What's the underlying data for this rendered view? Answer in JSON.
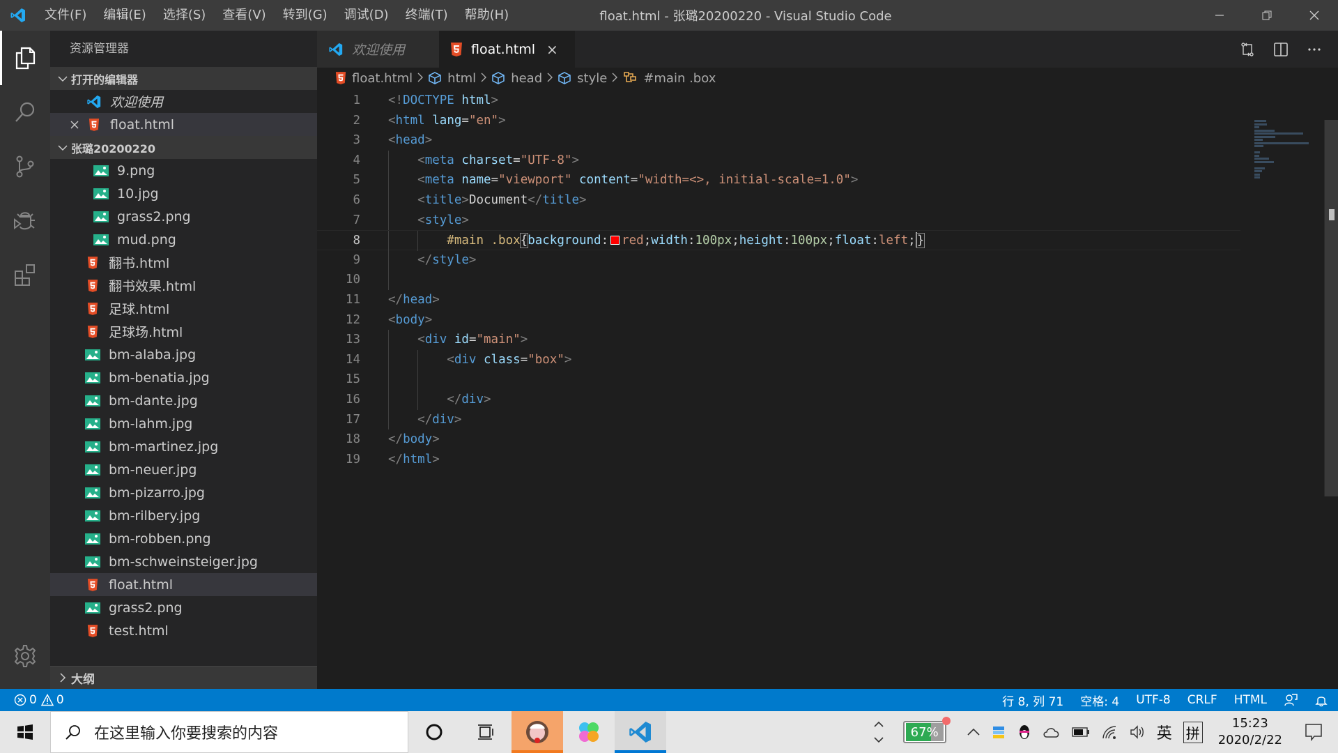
{
  "window": {
    "title": "float.html - 张璐20200220 - Visual Studio Code",
    "menu": [
      "文件(F)",
      "编辑(E)",
      "选择(S)",
      "查看(V)",
      "转到(G)",
      "调试(D)",
      "终端(T)",
      "帮助(H)"
    ]
  },
  "activity_bar": {
    "items": [
      "explorer-icon",
      "search-icon",
      "source-control-icon",
      "debug-icon",
      "extensions-icon"
    ],
    "bottom": "gear-icon"
  },
  "sidebar": {
    "title": "资源管理器",
    "open_editors": {
      "label": "打开的编辑器",
      "items": [
        {
          "label": "欢迎使用",
          "icon": "vscode-icon",
          "italic": true
        },
        {
          "label": "float.html",
          "icon": "html5-icon",
          "closable": true
        }
      ]
    },
    "folder": {
      "label": "张璐20200220",
      "items": [
        {
          "label": "9.png",
          "icon": "image-icon",
          "indent": 2
        },
        {
          "label": "10.jpg",
          "icon": "image-icon",
          "indent": 2
        },
        {
          "label": "grass2.png",
          "icon": "image-icon",
          "indent": 2
        },
        {
          "label": "mud.png",
          "icon": "image-icon",
          "indent": 2
        },
        {
          "label": "翻书.html",
          "icon": "html5-icon",
          "indent": 1
        },
        {
          "label": "翻书效果.html",
          "icon": "html5-icon",
          "indent": 1
        },
        {
          "label": "足球.html",
          "icon": "html5-icon",
          "indent": 1
        },
        {
          "label": "足球场.html",
          "icon": "html5-icon",
          "indent": 1
        },
        {
          "label": "bm-alaba.jpg",
          "icon": "image-icon",
          "indent": 1
        },
        {
          "label": "bm-benatia.jpg",
          "icon": "image-icon",
          "indent": 1
        },
        {
          "label": "bm-dante.jpg",
          "icon": "image-icon",
          "indent": 1
        },
        {
          "label": "bm-lahm.jpg",
          "icon": "image-icon",
          "indent": 1
        },
        {
          "label": "bm-martinez.jpg",
          "icon": "image-icon",
          "indent": 1
        },
        {
          "label": "bm-neuer.jpg",
          "icon": "image-icon",
          "indent": 1
        },
        {
          "label": "bm-pizarro.jpg",
          "icon": "image-icon",
          "indent": 1
        },
        {
          "label": "bm-rilbery.jpg",
          "icon": "image-icon",
          "indent": 1
        },
        {
          "label": "bm-robben.png",
          "icon": "image-icon",
          "indent": 1
        },
        {
          "label": "bm-schweinsteiger.jpg",
          "icon": "image-icon",
          "indent": 1
        },
        {
          "label": "float.html",
          "icon": "html5-icon",
          "indent": 1,
          "selected": true
        },
        {
          "label": "grass2.png",
          "icon": "image-icon",
          "indent": 1
        },
        {
          "label": "test.html",
          "icon": "html5-icon",
          "indent": 1
        }
      ]
    },
    "outline_label": "大纲"
  },
  "tabs": [
    {
      "label": "欢迎使用",
      "icon": "vscode-icon",
      "active": false
    },
    {
      "label": "float.html",
      "icon": "html5-icon",
      "active": true,
      "close": "×"
    }
  ],
  "breadcrumb": [
    {
      "label": "float.html",
      "icon": "html5-icon"
    },
    {
      "label": "html",
      "icon": "element-icon"
    },
    {
      "label": "head",
      "icon": "element-icon"
    },
    {
      "label": "style",
      "icon": "element-icon"
    },
    {
      "label": "#main .box",
      "icon": "css-selector-icon"
    }
  ],
  "code": {
    "current_line": 8,
    "lines": [
      [
        [
          "t-br",
          "<!"
        ],
        [
          "t-tag",
          "DOCTYPE"
        ],
        [
          "t-txt",
          " "
        ],
        [
          "t-attr",
          "html"
        ],
        [
          "t-br",
          ">"
        ]
      ],
      [
        [
          "t-br",
          "<"
        ],
        [
          "t-tag",
          "html"
        ],
        [
          "t-txt",
          " "
        ],
        [
          "t-attr",
          "lang"
        ],
        [
          "t-txt",
          "="
        ],
        [
          "t-str",
          "\"en\""
        ],
        [
          "t-br",
          ">"
        ]
      ],
      [
        [
          "t-br",
          "<"
        ],
        [
          "t-tag",
          "head"
        ],
        [
          "t-br",
          ">"
        ]
      ],
      [
        [
          "t-txt",
          "    "
        ],
        [
          "t-br",
          "<"
        ],
        [
          "t-tag",
          "meta"
        ],
        [
          "t-txt",
          " "
        ],
        [
          "t-attr",
          "charset"
        ],
        [
          "t-txt",
          "="
        ],
        [
          "t-str",
          "\"UTF-8\""
        ],
        [
          "t-br",
          ">"
        ]
      ],
      [
        [
          "t-txt",
          "    "
        ],
        [
          "t-br",
          "<"
        ],
        [
          "t-tag",
          "meta"
        ],
        [
          "t-txt",
          " "
        ],
        [
          "t-attr",
          "name"
        ],
        [
          "t-txt",
          "="
        ],
        [
          "t-str",
          "\"viewport\""
        ],
        [
          "t-txt",
          " "
        ],
        [
          "t-attr",
          "content"
        ],
        [
          "t-txt",
          "="
        ],
        [
          "t-str",
          "\"width=<>, initial-scale=1.0\""
        ],
        [
          "t-br",
          ">"
        ]
      ],
      [
        [
          "t-txt",
          "    "
        ],
        [
          "t-br",
          "<"
        ],
        [
          "t-tag",
          "title"
        ],
        [
          "t-br",
          ">"
        ],
        [
          "t-txt",
          "Document"
        ],
        [
          "t-br",
          "</"
        ],
        [
          "t-tag",
          "title"
        ],
        [
          "t-br",
          ">"
        ]
      ],
      [
        [
          "t-txt",
          "    "
        ],
        [
          "t-br",
          "<"
        ],
        [
          "t-tag",
          "style"
        ],
        [
          "t-br",
          ">"
        ]
      ],
      [
        [
          "t-txt",
          "        "
        ],
        [
          "t-sel",
          "#main .box"
        ],
        [
          "bracket-hl",
          "{"
        ],
        [
          "t-prop",
          "background"
        ],
        [
          "t-txt",
          ":"
        ],
        [
          "swatch",
          ""
        ],
        [
          "t-val",
          "red"
        ],
        [
          "t-txt",
          ";"
        ],
        [
          "t-prop",
          "width"
        ],
        [
          "t-txt",
          ":"
        ],
        [
          "t-num",
          "100px"
        ],
        [
          "t-txt",
          ";"
        ],
        [
          "t-prop",
          "height"
        ],
        [
          "t-txt",
          ":"
        ],
        [
          "t-num",
          "100px"
        ],
        [
          "t-txt",
          ";"
        ],
        [
          "t-prop",
          "float"
        ],
        [
          "t-txt",
          ":"
        ],
        [
          "t-val",
          "left"
        ],
        [
          "t-txt",
          ";"
        ],
        [
          "cursor",
          ""
        ],
        [
          "bracket-hl",
          "}"
        ]
      ],
      [
        [
          "t-txt",
          "    "
        ],
        [
          "t-br",
          "</"
        ],
        [
          "t-tag",
          "style"
        ],
        [
          "t-br",
          ">"
        ]
      ],
      [],
      [
        [
          "t-br",
          "</"
        ],
        [
          "t-tag",
          "head"
        ],
        [
          "t-br",
          ">"
        ]
      ],
      [
        [
          "t-br",
          "<"
        ],
        [
          "t-tag",
          "body"
        ],
        [
          "t-br",
          ">"
        ]
      ],
      [
        [
          "t-txt",
          "    "
        ],
        [
          "t-br",
          "<"
        ],
        [
          "t-tag",
          "div"
        ],
        [
          "t-txt",
          " "
        ],
        [
          "t-attr",
          "id"
        ],
        [
          "t-txt",
          "="
        ],
        [
          "t-str",
          "\"main\""
        ],
        [
          "t-br",
          ">"
        ]
      ],
      [
        [
          "t-txt",
          "        "
        ],
        [
          "t-br",
          "<"
        ],
        [
          "t-tag",
          "div"
        ],
        [
          "t-txt",
          " "
        ],
        [
          "t-attr",
          "class"
        ],
        [
          "t-txt",
          "="
        ],
        [
          "t-str",
          "\"box\""
        ],
        [
          "t-br",
          ">"
        ]
      ],
      [],
      [
        [
          "t-txt",
          "        "
        ],
        [
          "t-br",
          "</"
        ],
        [
          "t-tag",
          "div"
        ],
        [
          "t-br",
          ">"
        ]
      ],
      [
        [
          "t-txt",
          "    "
        ],
        [
          "t-br",
          "</"
        ],
        [
          "t-tag",
          "div"
        ],
        [
          "t-br",
          ">"
        ]
      ],
      [
        [
          "t-br",
          "</"
        ],
        [
          "t-tag",
          "body"
        ],
        [
          "t-br",
          ">"
        ]
      ],
      [
        [
          "t-br",
          "</"
        ],
        [
          "t-tag",
          "html"
        ],
        [
          "t-br",
          ">"
        ]
      ]
    ]
  },
  "statusbar": {
    "errors": "0",
    "warnings": "0",
    "position": "行 8, 列 71",
    "indent": "空格: 4",
    "encoding": "UTF-8",
    "eol": "CRLF",
    "language": "HTML"
  },
  "taskbar": {
    "search_placeholder": "在这里输入你要搜索的内容",
    "battery_percent": "67%",
    "ime_lang": "英",
    "ime_mode": "拼",
    "time": "15:23",
    "date": "2020/2/22"
  },
  "colors": {
    "accent": "#007acc",
    "html_icon": "#e44d26",
    "image_icon": "#26b08a",
    "vscode_blue": "#23a9f2"
  }
}
